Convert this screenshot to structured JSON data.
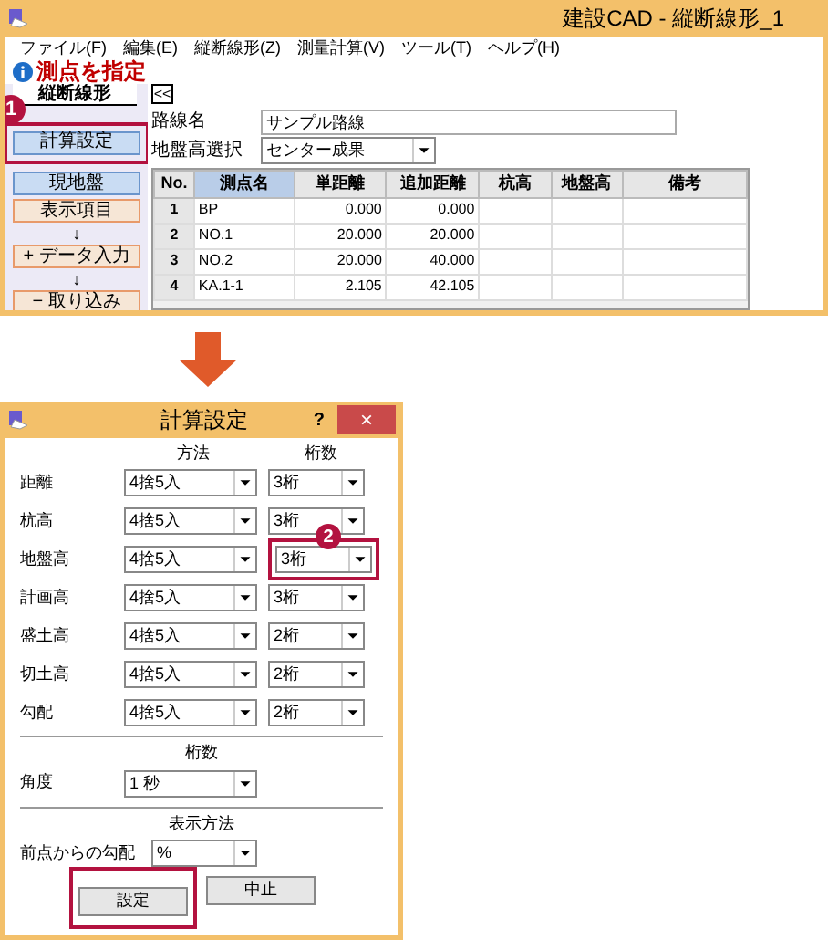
{
  "window": {
    "title": "建設CAD - 縦断線形_1"
  },
  "menu": [
    "ファイル(F)",
    "編集(E)",
    "縦断線形(Z)",
    "測量計算(V)",
    "ツール(T)",
    "ヘルプ(H)"
  ],
  "instruction": "測点を指定",
  "panel_tab": "縦断線形",
  "collapse_button": "<<",
  "sidebar": [
    {
      "label": "計算設定",
      "kind": "blue",
      "highlighted": true,
      "marker": "1"
    },
    {
      "label": "現地盤",
      "kind": "blue",
      "highlighted": false
    },
    {
      "label": "表示項目",
      "kind": "orange",
      "highlighted": false
    },
    {
      "label": "↓",
      "kind": "arrow",
      "highlighted": false
    },
    {
      "label": "+ データ入力",
      "kind": "orange",
      "highlighted": false
    },
    {
      "label": "↓",
      "kind": "arrow",
      "highlighted": false
    },
    {
      "label": "−  取り込み",
      "kind": "orange",
      "highlighted": false
    }
  ],
  "route": {
    "label": "路線名",
    "value": "サンプル路線"
  },
  "ground_select": {
    "label": "地盤高選択",
    "value": "センター成果"
  },
  "table": {
    "columns": [
      "No.",
      "測点名",
      "単距離",
      "追加距離",
      "杭高",
      "地盤高",
      "備考"
    ],
    "rows": [
      [
        "1",
        "BP",
        "0.000",
        "0.000",
        "",
        "",
        ""
      ],
      [
        "2",
        "NO.1",
        "20.000",
        "20.000",
        "",
        "",
        ""
      ],
      [
        "3",
        "NO.2",
        "20.000",
        "40.000",
        "",
        "",
        ""
      ],
      [
        "4",
        "KA.1-1",
        "2.105",
        "42.105",
        "",
        "",
        ""
      ]
    ]
  },
  "dialog": {
    "title": "計算設定",
    "help": "?",
    "close": "×",
    "headers": [
      "方法",
      "桁数"
    ],
    "rows": [
      {
        "label": "距離",
        "method": "4捨5入",
        "digits": "3桁",
        "highlighted": false
      },
      {
        "label": "杭高",
        "method": "4捨5入",
        "digits": "3桁",
        "highlighted": false
      },
      {
        "label": "地盤高",
        "method": "4捨5入",
        "digits": "3桁",
        "highlighted": true,
        "marker": "2"
      },
      {
        "label": "計画高",
        "method": "4捨5入",
        "digits": "3桁",
        "highlighted": false
      },
      {
        "label": "盛土高",
        "method": "4捨5入",
        "digits": "2桁",
        "highlighted": false
      },
      {
        "label": "切土高",
        "method": "4捨5入",
        "digits": "2桁",
        "highlighted": false
      },
      {
        "label": "勾配",
        "method": "4捨5入",
        "digits": "2桁",
        "highlighted": false
      }
    ],
    "angle_header": "桁数",
    "angle": {
      "label": "角度",
      "value": "1 秒"
    },
    "display_header": "表示方法",
    "slope": {
      "label": "前点からの勾配",
      "value": "%"
    },
    "buttons": [
      {
        "label": "設定",
        "highlighted": true
      },
      {
        "label": "中止",
        "highlighted": false
      }
    ]
  }
}
